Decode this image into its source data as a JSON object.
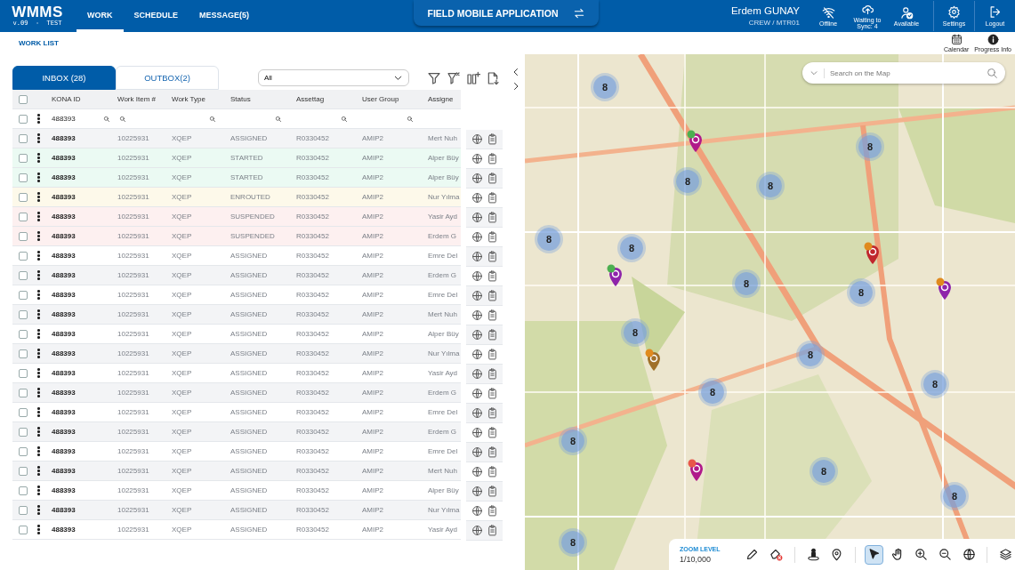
{
  "app": {
    "logo": "WMMS",
    "version": "v.09  -  TEST"
  },
  "nav": [
    {
      "label": "WORK",
      "selected": true
    },
    {
      "label": "SCHEDULE",
      "selected": false
    },
    {
      "label": "MESSAGE(5)",
      "selected": false
    }
  ],
  "center_button": {
    "label": "FIELD MOBILE APPLICATION"
  },
  "user": {
    "name": "Erdem GUNAY",
    "role": "CREW / MTR01"
  },
  "status_items": [
    {
      "kind": "offline",
      "label": "Offline"
    },
    {
      "kind": "sync",
      "label": "Waiting to Sync: 4"
    },
    {
      "kind": "available",
      "label": "Available"
    }
  ],
  "header_actions": [
    {
      "kind": "settings",
      "label": "Settings"
    },
    {
      "kind": "logout",
      "label": "Logout"
    }
  ],
  "page_title": "WORK LIST",
  "page_actions": [
    {
      "kind": "calendar",
      "label": "Calendar"
    },
    {
      "kind": "info",
      "label": "Progress Info"
    }
  ],
  "tabs": [
    {
      "label": "INBOX (28)",
      "selected": true
    },
    {
      "label": "OUTBOX(2)",
      "selected": false
    }
  ],
  "filter_select": {
    "value": "All"
  },
  "table": {
    "columns": [
      "KONA ID",
      "Work Item #",
      "Work Type",
      "Status",
      "Assettag",
      "User Group",
      "Assigne"
    ],
    "select_all_checked": false,
    "filter_checked": false,
    "filter_value": "488393",
    "rows": [
      {
        "kona_id": "488393",
        "work_item": "10225931",
        "work_type": "XQEP",
        "status": "ASSIGNED",
        "assettag": "R0330452",
        "user_group": "AMIP2",
        "assigned": "Mert Nuh",
        "color": "#f3f4f6",
        "checked": false
      },
      {
        "kona_id": "488393",
        "work_item": "10225931",
        "work_type": "XQEP",
        "status": "STARTED",
        "assettag": "R0330452",
        "user_group": "AMIP2",
        "assigned": "Alper Büy",
        "color": "#ebfaf3",
        "checked": false
      },
      {
        "kona_id": "488393",
        "work_item": "10225931",
        "work_type": "XQEP",
        "status": "STARTED",
        "assettag": "R0330452",
        "user_group": "AMIP2",
        "assigned": "Alper Büy",
        "color": "#ebfaf3",
        "checked": false
      },
      {
        "kona_id": "488393",
        "work_item": "10225931",
        "work_type": "XQEP",
        "status": "ENROUTED",
        "assettag": "R0330452",
        "user_group": "AMIP2",
        "assigned": "Nur Yılma",
        "color": "#fdf9ea",
        "checked": false
      },
      {
        "kona_id": "488393",
        "work_item": "10225931",
        "work_type": "XQEP",
        "status": "SUSPENDED",
        "assettag": "R0330452",
        "user_group": "AMIP2",
        "assigned": "Yasir Ayd",
        "color": "#fdf0f0",
        "checked": false
      },
      {
        "kona_id": "488393",
        "work_item": "10225931",
        "work_type": "XQEP",
        "status": "SUSPENDED",
        "assettag": "R0330452",
        "user_group": "AMIP2",
        "assigned": "Erdem G",
        "color": "#fdf0f0",
        "checked": false
      },
      {
        "kona_id": "488393",
        "work_item": "10225931",
        "work_type": "XQEP",
        "status": "ASSIGNED",
        "assettag": "R0330452",
        "user_group": "AMIP2",
        "assigned": "Emre Del",
        "color": "#ffffff",
        "checked": false
      },
      {
        "kona_id": "488393",
        "work_item": "10225931",
        "work_type": "XQEP",
        "status": "ASSIGNED",
        "assettag": "R0330452",
        "user_group": "AMIP2",
        "assigned": "Erdem G",
        "color": "#f3f4f6",
        "checked": false
      },
      {
        "kona_id": "488393",
        "work_item": "10225931",
        "work_type": "XQEP",
        "status": "ASSIGNED",
        "assettag": "R0330452",
        "user_group": "AMIP2",
        "assigned": "Emre Del",
        "color": "#ffffff",
        "checked": false
      },
      {
        "kona_id": "488393",
        "work_item": "10225931",
        "work_type": "XQEP",
        "status": "ASSIGNED",
        "assettag": "R0330452",
        "user_group": "AMIP2",
        "assigned": "Mert Nuh",
        "color": "#f3f4f6",
        "checked": false
      },
      {
        "kona_id": "488393",
        "work_item": "10225931",
        "work_type": "XQEP",
        "status": "ASSIGNED",
        "assettag": "R0330452",
        "user_group": "AMIP2",
        "assigned": "Alper Büy",
        "color": "#ffffff",
        "checked": false
      },
      {
        "kona_id": "488393",
        "work_item": "10225931",
        "work_type": "XQEP",
        "status": "ASSIGNED",
        "assettag": "R0330452",
        "user_group": "AMIP2",
        "assigned": "Nur Yılma",
        "color": "#f3f4f6",
        "checked": false
      },
      {
        "kona_id": "488393",
        "work_item": "10225931",
        "work_type": "XQEP",
        "status": "ASSIGNED",
        "assettag": "R0330452",
        "user_group": "AMIP2",
        "assigned": "Yasir Ayd",
        "color": "#ffffff",
        "checked": false
      },
      {
        "kona_id": "488393",
        "work_item": "10225931",
        "work_type": "XQEP",
        "status": "ASSIGNED",
        "assettag": "R0330452",
        "user_group": "AMIP2",
        "assigned": "Erdem G",
        "color": "#f3f4f6",
        "checked": false
      },
      {
        "kona_id": "488393",
        "work_item": "10225931",
        "work_type": "XQEP",
        "status": "ASSIGNED",
        "assettag": "R0330452",
        "user_group": "AMIP2",
        "assigned": "Emre Del",
        "color": "#ffffff",
        "checked": false
      },
      {
        "kona_id": "488393",
        "work_item": "10225931",
        "work_type": "XQEP",
        "status": "ASSIGNED",
        "assettag": "R0330452",
        "user_group": "AMIP2",
        "assigned": "Erdem G",
        "color": "#f3f4f6",
        "checked": false
      },
      {
        "kona_id": "488393",
        "work_item": "10225931",
        "work_type": "XQEP",
        "status": "ASSIGNED",
        "assettag": "R0330452",
        "user_group": "AMIP2",
        "assigned": "Emre Del",
        "color": "#ffffff",
        "checked": false
      },
      {
        "kona_id": "488393",
        "work_item": "10225931",
        "work_type": "XQEP",
        "status": "ASSIGNED",
        "assettag": "R0330452",
        "user_group": "AMIP2",
        "assigned": "Mert Nuh",
        "color": "#f3f4f6",
        "checked": false
      },
      {
        "kona_id": "488393",
        "work_item": "10225931",
        "work_type": "XQEP",
        "status": "ASSIGNED",
        "assettag": "R0330452",
        "user_group": "AMIP2",
        "assigned": "Alper Büy",
        "color": "#ffffff",
        "checked": false
      },
      {
        "kona_id": "488393",
        "work_item": "10225931",
        "work_type": "XQEP",
        "status": "ASSIGNED",
        "assettag": "R0330452",
        "user_group": "AMIP2",
        "assigned": "Nur Yılma",
        "color": "#f3f4f6",
        "checked": false
      },
      {
        "kona_id": "488393",
        "work_item": "10225931",
        "work_type": "XQEP",
        "status": "ASSIGNED",
        "assettag": "R0330452",
        "user_group": "AMIP2",
        "assigned": "Yasir Ayd",
        "color": "#ffffff",
        "checked": false
      }
    ]
  },
  "map": {
    "search_placeholder": "Search on the Map",
    "clusters": [
      {
        "count": "8"
      },
      {
        "count": "8"
      },
      {
        "count": "8"
      },
      {
        "count": "8"
      },
      {
        "count": "8"
      },
      {
        "count": "8"
      },
      {
        "count": "8"
      },
      {
        "count": "8"
      },
      {
        "count": "8"
      },
      {
        "count": "8"
      },
      {
        "count": "8"
      },
      {
        "count": "8"
      },
      {
        "count": "8"
      },
      {
        "count": "8"
      },
      {
        "count": "8"
      },
      {
        "count": "8"
      }
    ],
    "pins": [
      {
        "color": "#b0198a",
        "kind": "route"
      },
      {
        "color": "#c0262d",
        "kind": "person"
      },
      {
        "color": "#8e24aa",
        "kind": "route"
      },
      {
        "color": "#8e24aa",
        "kind": "person"
      },
      {
        "color": "#a0702a",
        "kind": "person"
      },
      {
        "color": "#b0198a",
        "kind": "alert"
      }
    ],
    "zoom_label": "ZOOM LEVEL",
    "zoom_value": "1/10,000",
    "tools": [
      {
        "kind": "pencil",
        "selected": false
      },
      {
        "kind": "erase",
        "selected": false
      },
      {
        "kind": "sep"
      },
      {
        "kind": "person",
        "selected": false
      },
      {
        "kind": "pin",
        "selected": false
      },
      {
        "kind": "sep"
      },
      {
        "kind": "cursor",
        "selected": true
      },
      {
        "kind": "hand",
        "selected": false
      },
      {
        "kind": "zoom-in",
        "selected": false
      },
      {
        "kind": "zoom-out",
        "selected": false
      },
      {
        "kind": "globe",
        "selected": false
      },
      {
        "kind": "sep"
      },
      {
        "kind": "layers",
        "selected": false
      }
    ]
  }
}
